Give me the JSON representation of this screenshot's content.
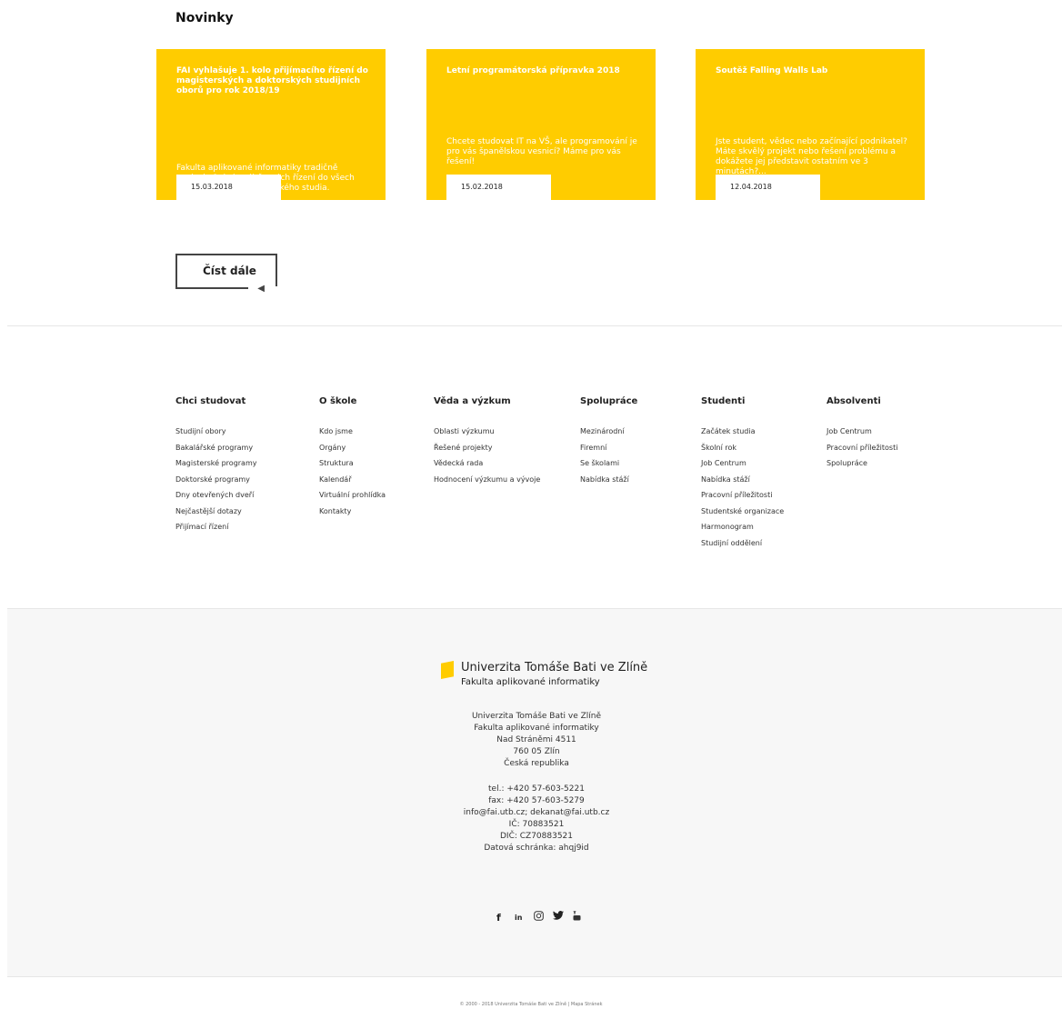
{
  "news": {
    "heading": "Novinky",
    "cards": [
      {
        "title": "FAI vyhlašuje 1. kolo přijímacího řízení do magisterských a doktorských studijních oborů pro rok 2018/19",
        "desc": "Fakulta aplikované informatiky tradičně vypisuje 1. kola výběrových řízení do všech třech stupňů vysokoškolského studia.",
        "date": "15.03.2018"
      },
      {
        "title": "Letní programátorská přípravka 2018",
        "desc": "Chcete studovat IT na VŠ, ale programování je pro vás španělskou vesnicí? Máme pro vás řešení!",
        "date": "15.02.2018"
      },
      {
        "title": "Soutěž Falling Walls Lab",
        "desc": "Jste student, vědec nebo začínající podnikatel? Máte skvělý projekt nebo řešení problému a dokážete jej představit ostatním ve 3 minutách?...",
        "date": "12.04.2018"
      }
    ],
    "read_more": "Číst dále"
  },
  "footer_nav": [
    {
      "heading": "Chci studovat",
      "links": [
        "Studijní obory",
        "Bakalářské programy",
        "Magisterské programy",
        "Doktorské programy",
        "Dny otevřených dveří",
        "Nejčastější dotazy",
        "Přijímací řízení"
      ]
    },
    {
      "heading": "O škole",
      "links": [
        "Kdo jsme",
        "Orgány",
        "Struktura",
        "Kalendář",
        "Virtuální prohlídka",
        "Kontakty"
      ]
    },
    {
      "heading": "Věda a výzkum",
      "links": [
        "Oblasti výzkumu",
        "Řešené projekty",
        "Vědecká rada",
        "Hodnocení výzkumu a vývoje"
      ]
    },
    {
      "heading": "Spolupráce",
      "links": [
        "Mezinárodní",
        "Firemní",
        "Se školami",
        "Nabídka stáží"
      ]
    },
    {
      "heading": "Studenti",
      "links": [
        "Začátek studia",
        "Školní rok",
        "Job Centrum",
        "Nabídka stáží",
        "Pracovní příležitosti",
        "Studentské organizace",
        "Harmonogram",
        "Studijní oddělení"
      ]
    },
    {
      "heading": "Absolventi",
      "links": [
        "Job Centrum",
        "Pracovní příležitosti",
        "Spolupráce"
      ]
    }
  ],
  "footer": {
    "logo_main": "Univerzita Tomáše Bati ve Zlíně",
    "logo_sub": "Fakulta aplikované informatiky",
    "address": [
      "Univerzita Tomáše Bati ve Zlíně",
      "Fakulta aplikované informatiky",
      "Nad Stráněmi 4511",
      "760 05 Zlín",
      "Česká republika"
    ],
    "contact": [
      "tel.: +420 57-603-5221",
      "fax: +420 57-603-5279",
      "info@fai.utb.cz; dekanat@fai.utb.cz",
      "IČ: 70883521",
      "DIČ: CZ70883521",
      "Datová schránka: ahqj9id"
    ],
    "social": [
      "facebook-icon",
      "linkedin-icon",
      "instagram-icon",
      "twitter-icon",
      "youtube-icon"
    ],
    "copyright": "© 2000 - 2018 Univerzita Tomáše Bati ve Zlíně  |  Mapa Stránek"
  },
  "colors": {
    "accent": "#ffcc00",
    "footer_bg": "#f7f7f7",
    "text": "#222222"
  }
}
